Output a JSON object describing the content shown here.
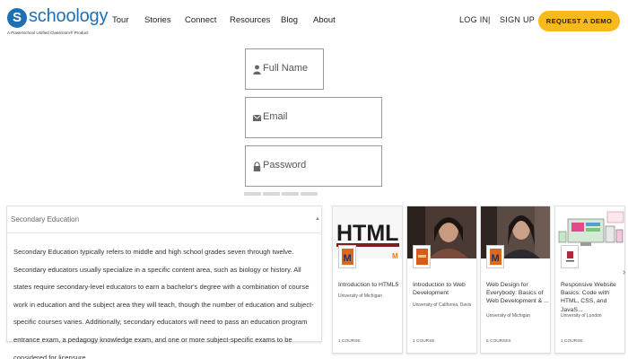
{
  "brand": {
    "name": "schoology",
    "mark": "S",
    "tagline": "A PowerSchool Unified Classroom® Product",
    "color": "#1f6fb5"
  },
  "nav": {
    "items": [
      "Tour",
      "Stories",
      "Connect",
      "Resources",
      "Blog",
      "About"
    ],
    "login": "LOG IN",
    "separator": "|",
    "signup": "SIGN UP",
    "demo": "REQUEST A DEMO",
    "demo_color": "#f8b91b"
  },
  "form": {
    "full_name_placeholder": "Full Name",
    "email_placeholder": "Email",
    "password_placeholder": "Password",
    "pager_pages": 4
  },
  "panel": {
    "title": "Secondary Education",
    "body": "Secondary Education typically refers to middle and high school grades seven through twelve. Secondary educators usually specialize in a specific content area, such as biology or history. All states require secondary-level educators to earn a bachelor's degree with a combination of course work in education and the subject area they will teach, though the number of education and subject-specific courses varies. Additionally, secondary educators will need to pass an education program entrance exam, a pedagogy knowledge exam, and one or more subject-specific exams to be considered for licensure."
  },
  "courses": [
    {
      "title": "Introduction to HTML5",
      "institution": "University of Michigan",
      "count": "1 COURSE",
      "thumb": "html-logo",
      "badge": "michigan-icon"
    },
    {
      "title": "Introduction to Web Development",
      "institution": "University of California, Davis",
      "count": "1 COURSE",
      "thumb": "instructor-video",
      "badge": "uc-davis-icon"
    },
    {
      "title": "Web Design for Everybody: Basics of Web Development & ...",
      "institution": "University of Michigan",
      "count": "5 COURSES",
      "thumb": "instructor-video",
      "badge": "michigan-icon"
    },
    {
      "title": "Responsive Website Basics: Code with HTML, CSS, and JavaS...",
      "institution": "University of London",
      "count": "1 COURSE",
      "thumb": "responsive-devices",
      "badge": "london-icon"
    }
  ],
  "thumb_html_text": "HTML"
}
